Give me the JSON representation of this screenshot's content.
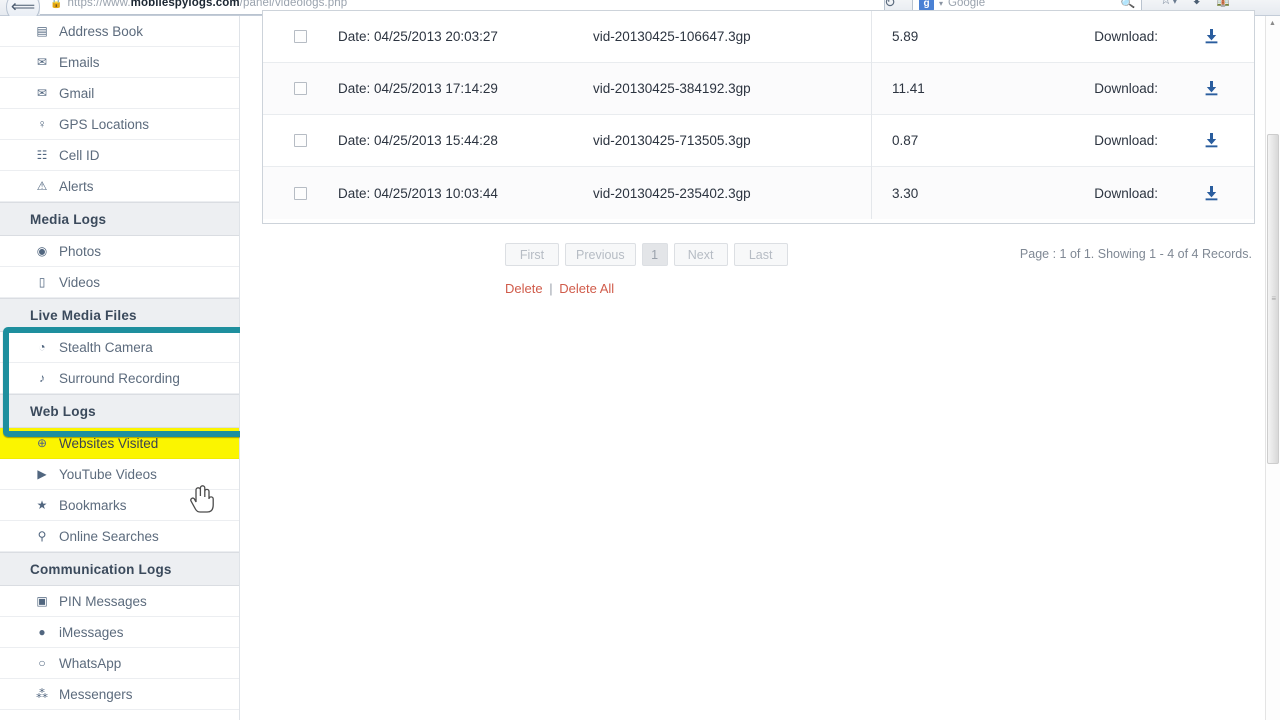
{
  "browser": {
    "back_icon": "back-arrow-icon",
    "lock_icon": "lock-icon",
    "url_prefix": "https://www.",
    "url_domain": "mobilespylogs.com",
    "url_suffix": "/panel/videologs.php",
    "reload_icon": "reload-icon",
    "search_engine": "Google",
    "search_engine_badge": "g",
    "search_placeholder": "Google",
    "search_icon": "magnifier-icon",
    "bookmark_icon": "bookmark-star-icon",
    "download_icon": "download-arrow-icon",
    "home_icon": "home-icon"
  },
  "sidebar": {
    "top_items": [
      {
        "label": "Address Book",
        "icon": "address-book-icon",
        "glyph": "▤"
      },
      {
        "label": "Emails",
        "icon": "envelope-icon",
        "glyph": "✉"
      },
      {
        "label": "Gmail",
        "icon": "gmail-envelope-icon",
        "glyph": "✉"
      },
      {
        "label": "GPS Locations",
        "icon": "map-pin-icon",
        "glyph": "♀"
      },
      {
        "label": "Cell ID",
        "icon": "cell-tower-icon",
        "glyph": "☷"
      },
      {
        "label": "Alerts",
        "icon": "warning-triangle-icon",
        "glyph": "⚠"
      }
    ],
    "groups": [
      {
        "title": "Media Logs",
        "items": [
          {
            "label": "Photos",
            "icon": "camera-icon",
            "glyph": "◉"
          },
          {
            "label": "Videos",
            "icon": "video-icon",
            "glyph": "▯"
          }
        ]
      },
      {
        "title": "Live Media Files",
        "items": [
          {
            "label": "Stealth Camera",
            "icon": "stealth-camera-icon",
            "glyph": "◔"
          },
          {
            "label": "Surround Recording",
            "icon": "microphone-icon",
            "glyph": "♪"
          }
        ]
      },
      {
        "title": "Web Logs",
        "items": [
          {
            "label": "Websites Visited",
            "icon": "globe-icon",
            "glyph": "⊕",
            "highlighted": true
          },
          {
            "label": "YouTube Videos",
            "icon": "youtube-icon",
            "glyph": "▶"
          },
          {
            "label": "Bookmarks",
            "icon": "star-icon",
            "glyph": "★"
          },
          {
            "label": "Online Searches",
            "icon": "search-icon",
            "glyph": "⚲"
          }
        ]
      },
      {
        "title": "Communication Logs",
        "items": [
          {
            "label": "PIN Messages",
            "icon": "pin-messages-icon",
            "glyph": "▣"
          },
          {
            "label": "iMessages",
            "icon": "imessages-icon",
            "glyph": "●"
          },
          {
            "label": "WhatsApp",
            "icon": "whatsapp-icon",
            "glyph": "○"
          },
          {
            "label": "Messengers",
            "icon": "messengers-icon",
            "glyph": "⁂"
          }
        ]
      }
    ]
  },
  "annotations": {
    "box_color": "#1e8f9e",
    "highlight_color": "#fbf500",
    "cursor_icon": "pointing-hand-cursor"
  },
  "table": {
    "rows": [
      {
        "date": "Date: 04/25/2013 20:03:27",
        "file": "vid-20130425-106647.3gp",
        "size": "5.89",
        "download_label": "Download:"
      },
      {
        "date": "Date: 04/25/2013 17:14:29",
        "file": "vid-20130425-384192.3gp",
        "size": "11.41",
        "download_label": "Download:"
      },
      {
        "date": "Date: 04/25/2013 15:44:28",
        "file": "vid-20130425-713505.3gp",
        "size": "0.87",
        "download_label": "Download:"
      },
      {
        "date": "Date: 04/25/2013 10:03:44",
        "file": "vid-20130425-235402.3gp",
        "size": "3.30",
        "download_label": "Download:"
      }
    ]
  },
  "pagination": {
    "first": "First",
    "previous": "Previous",
    "current_page": "1",
    "next": "Next",
    "last": "Last",
    "info": "Page : 1 of 1. Showing 1 - 4 of 4 Records."
  },
  "actions": {
    "delete": "Delete",
    "separator": "|",
    "delete_all": "Delete All"
  },
  "scrollbar": {
    "up_arrow": "▲",
    "grip": "≡"
  }
}
